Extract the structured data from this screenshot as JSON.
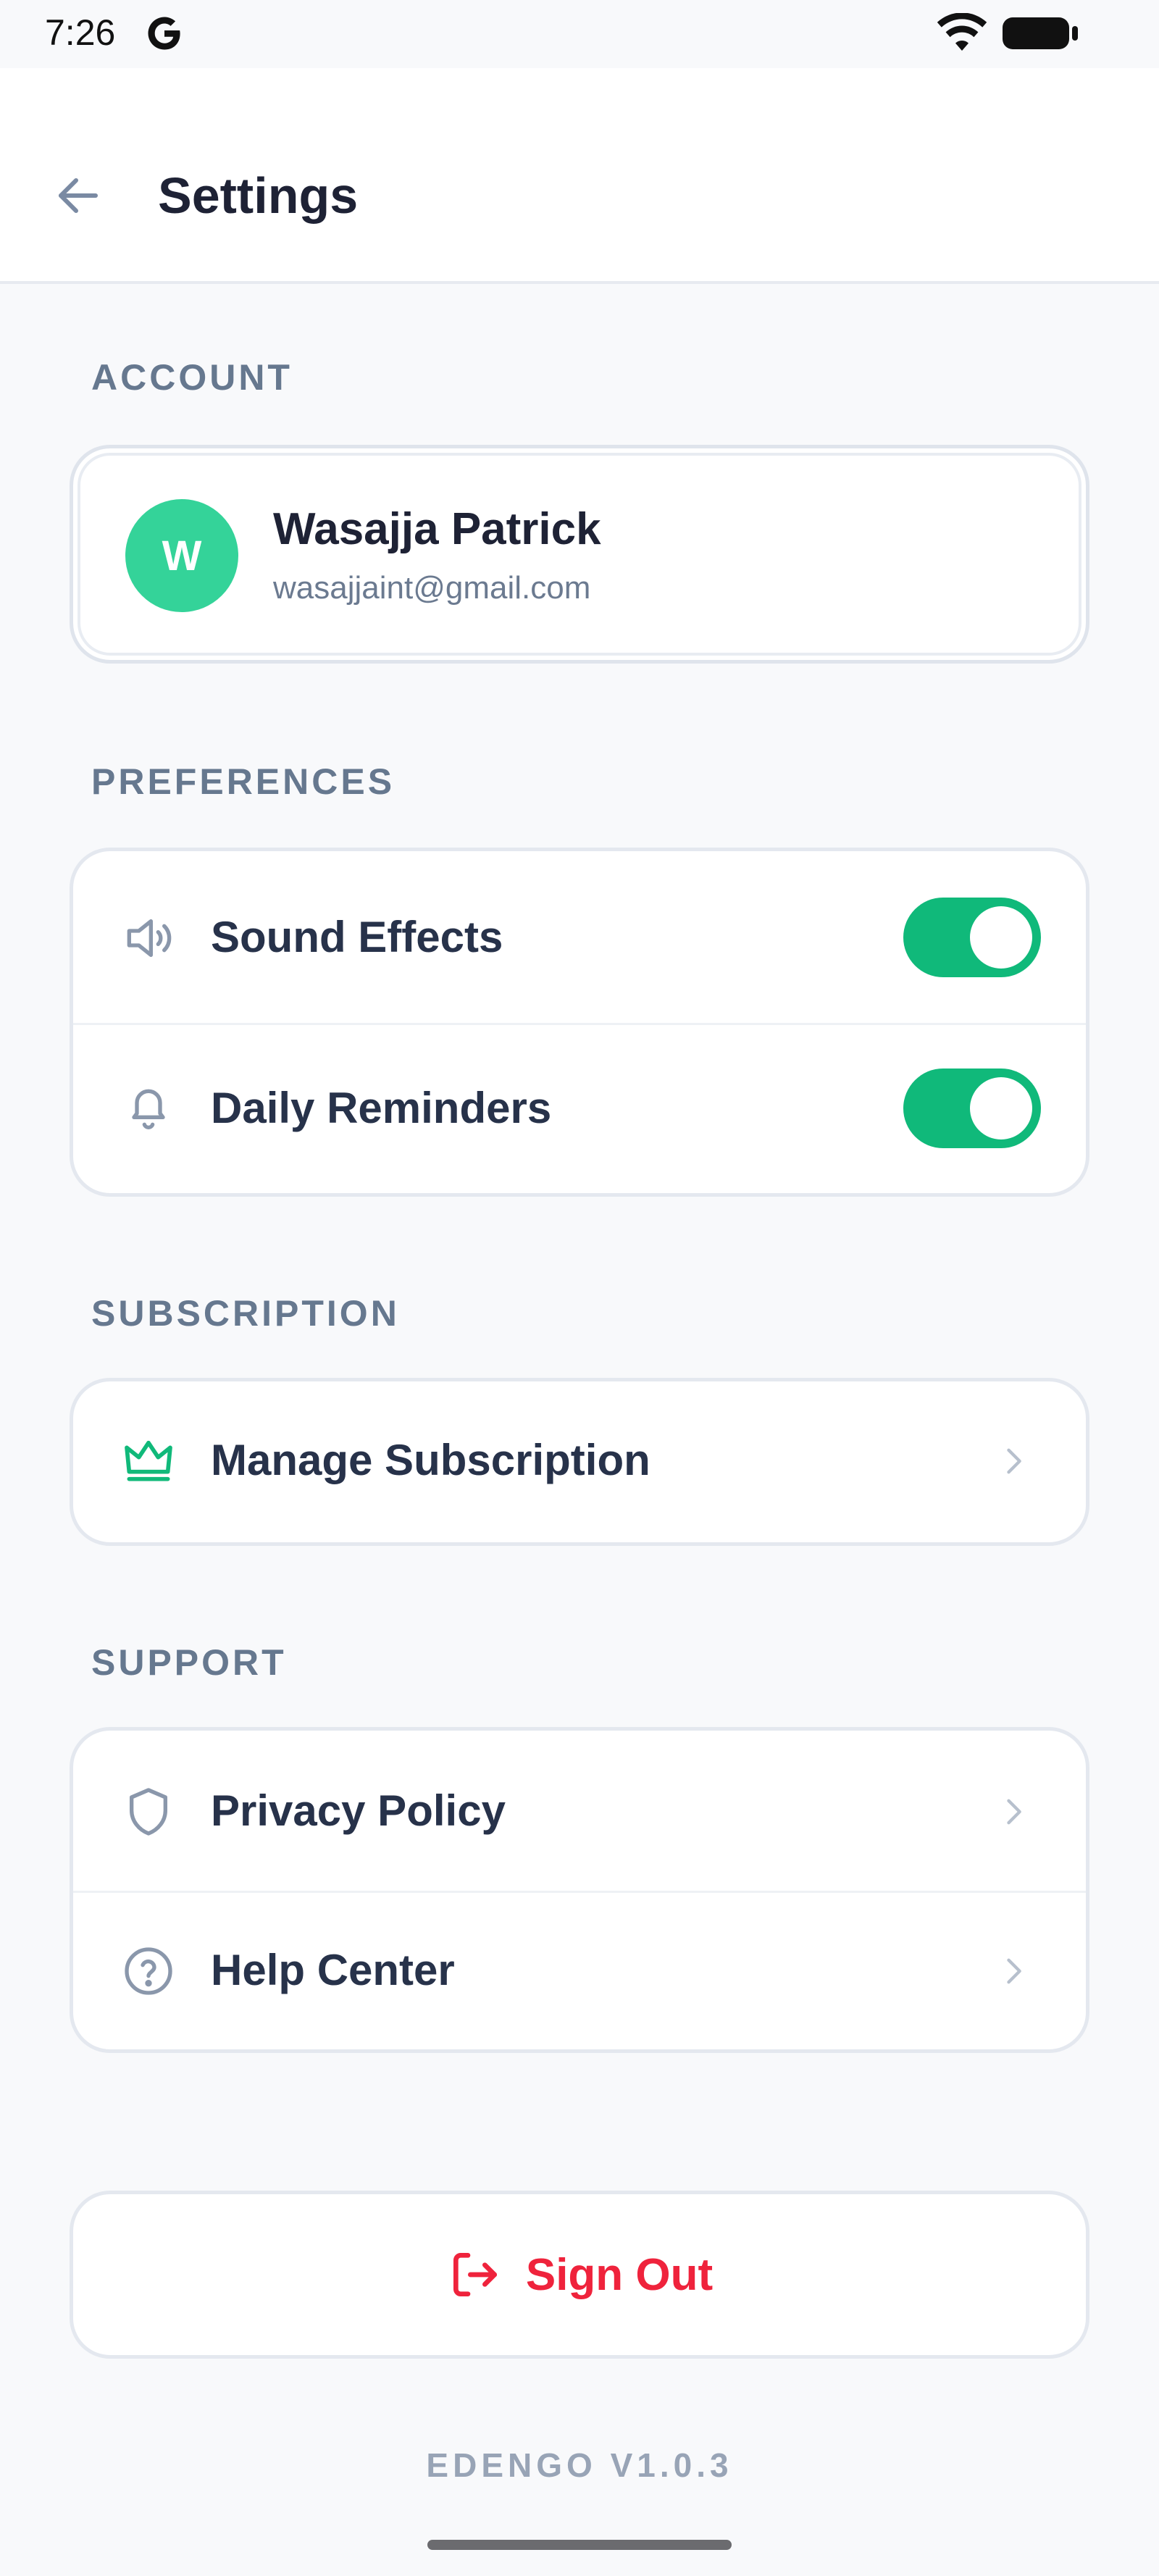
{
  "status_bar": {
    "time": "7:26"
  },
  "header": {
    "title": "Settings"
  },
  "sections": {
    "account": "ACCOUNT",
    "preferences": "PREFERENCES",
    "subscription": "SUBSCRIPTION",
    "support": "SUPPORT"
  },
  "account": {
    "avatar_initial": "W",
    "name": "Wasajja Patrick",
    "email": "wasajjaint@gmail.com"
  },
  "preferences": [
    {
      "label": "Sound Effects",
      "icon": "speaker-icon",
      "enabled": true
    },
    {
      "label": "Daily Reminders",
      "icon": "bell-icon",
      "enabled": true
    }
  ],
  "subscription": {
    "label": "Manage Subscription",
    "icon": "crown-icon"
  },
  "support": [
    {
      "label": "Privacy Policy",
      "icon": "shield-icon"
    },
    {
      "label": "Help Center",
      "icon": "help-circle-icon"
    }
  ],
  "sign_out": {
    "label": "Sign Out",
    "icon": "logout-icon"
  },
  "version": "EDENGO V1.0.3",
  "colors": {
    "accent_green": "#10b97a",
    "avatar_green": "#34d399",
    "danger_red": "#ef233c",
    "section_label": "#66788f"
  }
}
